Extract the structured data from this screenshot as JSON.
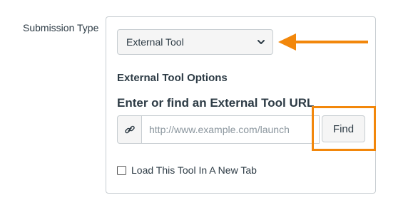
{
  "submission": {
    "label": "Submission Type",
    "selected_type": "External Tool"
  },
  "external_tool": {
    "options_heading": "External Tool Options",
    "url_heading": "Enter or find an External Tool URL",
    "url_placeholder": "http://www.example.com/launch",
    "url_value": "",
    "find_label": "Find",
    "new_tab_label": "Load This Tool In A New Tab",
    "new_tab_checked": false
  },
  "icons": {
    "select": "chevron-down-icon",
    "url_prefix": "link-icon",
    "annotation": "arrow-left-icon"
  },
  "colors": {
    "annotation": "#f2870b",
    "text": "#2d3b45",
    "border": "#c7cdd1"
  }
}
